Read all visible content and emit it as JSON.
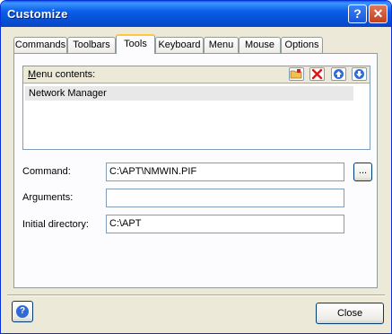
{
  "window": {
    "title": "Customize"
  },
  "tabs": [
    {
      "label": "Commands"
    },
    {
      "label": "Toolbars"
    },
    {
      "label": "Tools"
    },
    {
      "label": "Keyboard"
    },
    {
      "label": "Menu"
    },
    {
      "label": "Mouse"
    },
    {
      "label": "Options"
    }
  ],
  "active_tab": "Tools",
  "menu_contents": {
    "label_accel": "M",
    "label_rest": "enu contents:",
    "items": [
      "Network Manager"
    ],
    "toolbar_icons": [
      "new-folder-icon",
      "delete-icon",
      "move-up-icon",
      "move-down-icon"
    ]
  },
  "fields": {
    "command_label": "Command:",
    "command_value": "C:\\APT\\NMWIN.PIF",
    "arguments_label": "Arguments:",
    "arguments_value": "",
    "initial_dir_label": "Initial directory:",
    "initial_dir_value": "C:\\APT",
    "browse_label": "..."
  },
  "footer": {
    "close_label": "Close"
  },
  "colors": {
    "titlebar": "#0b5ee8",
    "active_tab_accent": "#ffc83c",
    "dialog_bg": "#ece9d8"
  }
}
